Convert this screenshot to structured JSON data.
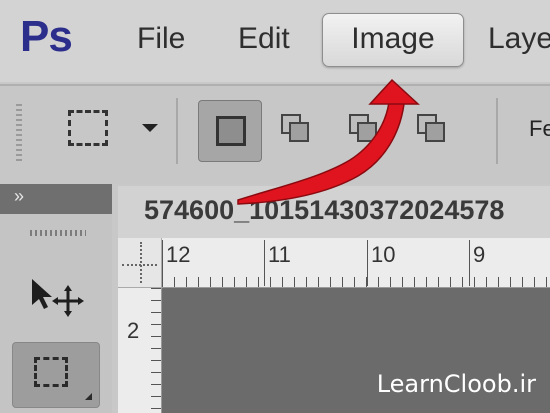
{
  "app": {
    "logo_text": "Ps",
    "logo_color": "#2b2e8a"
  },
  "menu": {
    "items": [
      {
        "label": "File"
      },
      {
        "label": "Edit"
      },
      {
        "label": "Image",
        "highlighted": true
      },
      {
        "label": "Layer"
      }
    ]
  },
  "options_bar": {
    "tool_icon": "rectangular-marquee-icon",
    "selection_modes": [
      {
        "icon": "new-selection-icon",
        "active": true
      },
      {
        "icon": "add-to-selection-icon",
        "active": false
      },
      {
        "icon": "subtract-from-selection-icon",
        "active": false
      },
      {
        "icon": "intersect-selection-icon",
        "active": false
      }
    ],
    "feather_label": "Fe"
  },
  "tools_panel": {
    "collapse_icon": "»",
    "tools": [
      {
        "icon": "move-tool-icon",
        "active": false
      },
      {
        "icon": "rectangular-marquee-icon",
        "active": true
      }
    ]
  },
  "document": {
    "tab_title": "574600_10151430372024578"
  },
  "rulers": {
    "horizontal": [
      "12",
      "11",
      "10",
      "9"
    ],
    "vertical": [
      "2"
    ]
  },
  "annotation": {
    "arrow_color": "#e0141e",
    "arrow_target": "Image menu"
  },
  "watermark": "LearnCloob.ir"
}
